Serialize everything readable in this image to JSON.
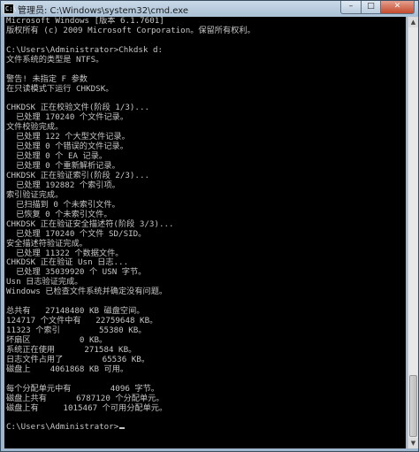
{
  "window": {
    "title": "管理员: C:\\Windows\\system32\\cmd.exe",
    "icon": "console-icon",
    "controls": {
      "minimize": "–",
      "maximize": "□",
      "close": "✕"
    }
  },
  "console": {
    "lines": [
      "Microsoft Windows [版本 6.1.7601]",
      "版权所有 (c) 2009 Microsoft Corporation。保留所有权利。",
      "",
      "C:\\Users\\Administrator>Chkdsk d:",
      "文件系统的类型是 NTFS。",
      "",
      "警告! 未指定 F 参数",
      "在只读模式下运行 CHKDSK。",
      "",
      "CHKDSK 正在校验文件(阶段 1/3)...",
      "  已处理 170240 个文件记录。",
      "文件校验完成。",
      "  已处理 122 个大型文件记录。",
      "  已处理 0 个错误的文件记录。",
      "  已处理 0 个 EA 记录。",
      "  已处理 0 个重新解析记录。",
      "CHKDSK 正在验证索引(阶段 2/3)...",
      "  已处理 192882 个索引项。",
      "索引验证完成。",
      "  已扫描到 0 个未索引文件。",
      "  已恢复 0 个未索引文件。",
      "CHKDSK 正在验证安全描述符(阶段 3/3)...",
      "  已处理 170240 个文件 SD/SID。",
      "安全描述符验证完成。",
      "  已处理 11322 个数据文件。",
      "CHKDSK 正在验证 Usn 日志...",
      "  已处理 35039920 个 USN 字节。",
      "Usn 日志验证完成。",
      "Windows 已检查文件系统并确定没有问题。",
      "",
      "总共有   27148480 KB 磁盘空间。",
      "124717 个文件中有   22759648 KB。",
      "11323 个索引        55380 KB。",
      "坏扇区          0 KB。",
      "系统正在使用      271584 KB。",
      "日志文件占用了        65536 KB。",
      "磁盘上    4061868 KB 可用。",
      "",
      "每个分配单元中有        4096 字节。",
      "磁盘上共有      6787120 个分配单元。",
      "磁盘上有     1015467 个可用分配单元。",
      "",
      "C:\\Users\\Administrator>"
    ]
  }
}
